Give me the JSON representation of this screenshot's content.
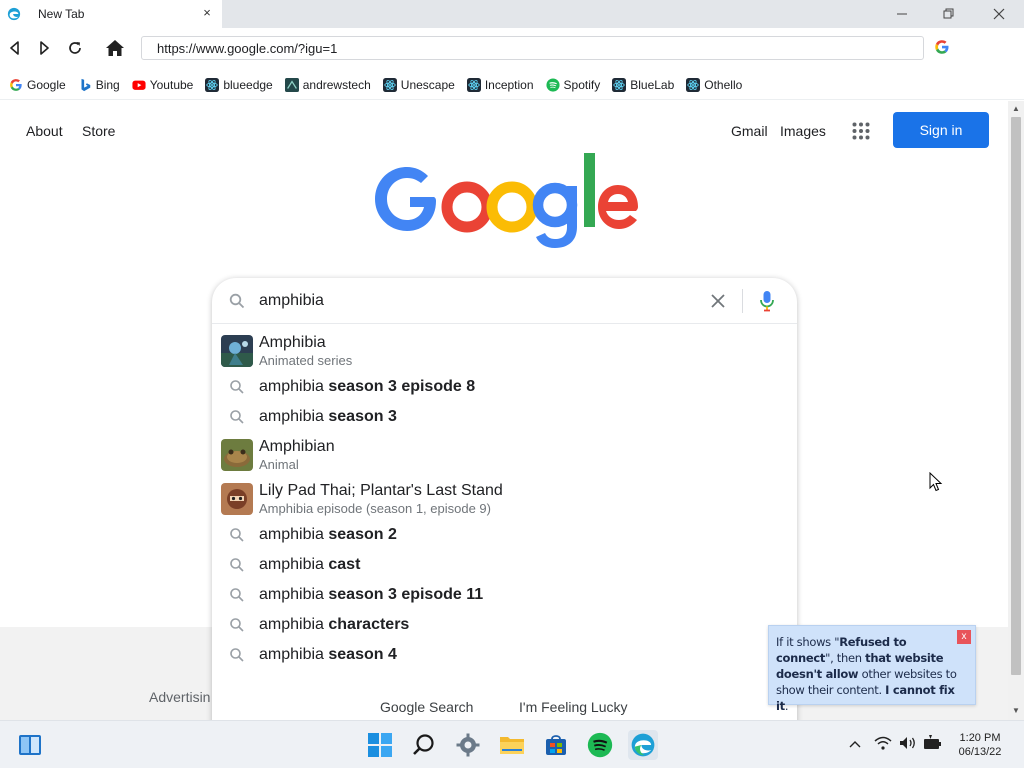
{
  "browser": {
    "tab_title": "New Tab",
    "tab_close": "×",
    "url": "https://www.google.com/?igu=1"
  },
  "bookmarks": [
    {
      "label": "Google",
      "icon": "google-icon"
    },
    {
      "label": "Bing",
      "icon": "bing-icon"
    },
    {
      "label": "Youtube",
      "icon": "youtube-icon"
    },
    {
      "label": "blueedge",
      "icon": "react-icon"
    },
    {
      "label": "andrewstech",
      "icon": "andrewstech-icon"
    },
    {
      "label": "Unescape",
      "icon": "react-icon"
    },
    {
      "label": "Inception",
      "icon": "react-icon"
    },
    {
      "label": "Spotify",
      "icon": "spotify-icon"
    },
    {
      "label": "BlueLab",
      "icon": "react-icon"
    },
    {
      "label": "Othello",
      "icon": "react-icon"
    }
  ],
  "google": {
    "about": "About",
    "store": "Store",
    "gmail": "Gmail",
    "images": "Images",
    "sign_in": "Sign in",
    "query": "amphibia",
    "suggestions": [
      {
        "kind": "entity",
        "title": "Amphibia",
        "subtitle": "Animated series",
        "thumb": "amphibia-thumbnail"
      },
      {
        "kind": "query",
        "prefix": "amphibia",
        "bold": " season 3 episode 8"
      },
      {
        "kind": "query",
        "prefix": "amphibia",
        "bold": " season 3"
      },
      {
        "kind": "entity",
        "title": "Amphibian",
        "subtitle": "Animal",
        "thumb": "frog-thumbnail"
      },
      {
        "kind": "entity",
        "title": "Lily Pad Thai; Plantar's Last Stand",
        "subtitle": "Amphibia episode (season 1, episode 9)",
        "thumb": "episode-thumbnail"
      },
      {
        "kind": "query",
        "prefix": "amphibia",
        "bold": " season 2"
      },
      {
        "kind": "query",
        "prefix": "amphibia",
        "bold": " cast"
      },
      {
        "kind": "query",
        "prefix": "amphibia",
        "bold": " season 3 episode 11"
      },
      {
        "kind": "query",
        "prefix": "amphibia",
        "bold": " characters"
      },
      {
        "kind": "query",
        "prefix": "amphibia",
        "bold": " season 4"
      }
    ],
    "google_search": "Google Search",
    "feeling_lucky": "I'm Feeling Lucky",
    "advertising": "Advertisin"
  },
  "tooltip": {
    "p1": "If it shows \"",
    "b1": "Refused to connect",
    "p2": "\", then ",
    "b2": "that website doesn't allow",
    "p3": " other websites to show their content. ",
    "b3": "I cannot fix it",
    "p4": ".",
    "close": "x"
  },
  "taskbar": {
    "time": "1:20 PM",
    "date": "06/13/22"
  },
  "colors": {
    "accent": "#1a73e8",
    "google_blue": "#4285f4",
    "google_red": "#ea4335",
    "google_yellow": "#fbbc05",
    "google_green": "#34a853"
  }
}
